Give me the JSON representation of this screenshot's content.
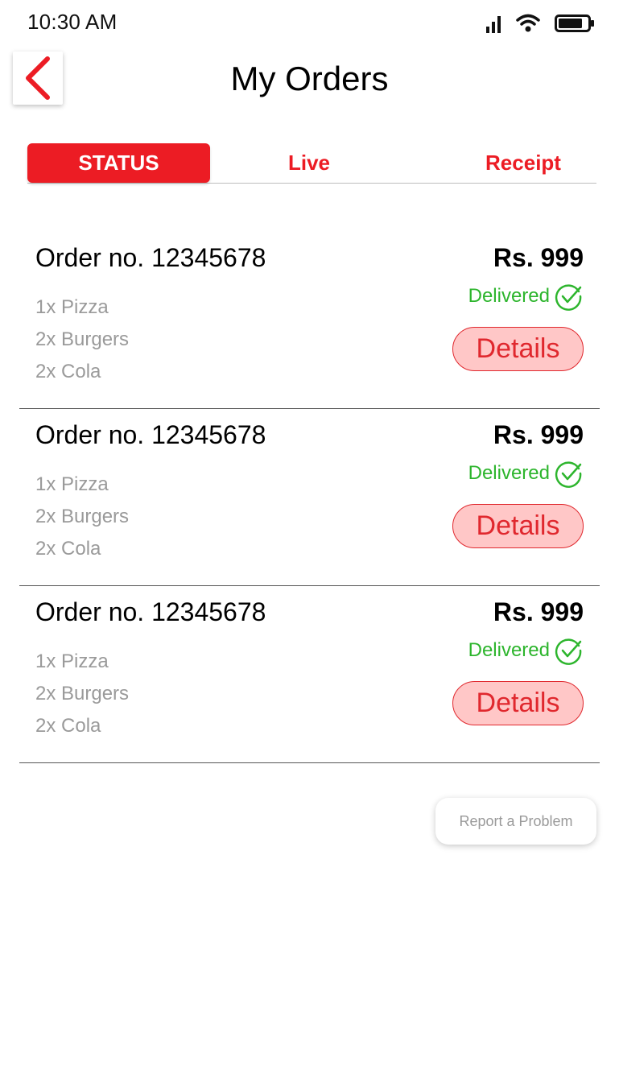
{
  "status_bar": {
    "time": "10:30 AM",
    "icons": [
      "signal-icon",
      "wifi-icon",
      "battery-icon"
    ]
  },
  "header": {
    "back_icon": "chevron-left-icon",
    "title": "My Orders"
  },
  "tabs": [
    {
      "label": "STATUS",
      "active": true
    },
    {
      "label": "Live",
      "active": false
    },
    {
      "label": "Receipt",
      "active": false
    }
  ],
  "orders": [
    {
      "number": "Order no. 12345678",
      "items": [
        "1x Pizza",
        "2x Burgers",
        "2x Cola"
      ],
      "price": "Rs. 999",
      "status": "Delivered",
      "status_icon": "check-circle-icon",
      "details_label": "Details"
    },
    {
      "number": "Order no. 12345678",
      "items": [
        "1x Pizza",
        "2x Burgers",
        "2x Cola"
      ],
      "price": "Rs. 999",
      "status": "Delivered",
      "status_icon": "check-circle-icon",
      "details_label": "Details"
    },
    {
      "number": "Order no. 12345678",
      "items": [
        "1x Pizza",
        "2x Burgers",
        "2x Cola"
      ],
      "price": "Rs. 999",
      "status": "Delivered",
      "status_icon": "check-circle-icon",
      "details_label": "Details"
    }
  ],
  "report_button": "Report a Problem",
  "colors": {
    "accent": "#ec1c24",
    "delivered": "#2db52d",
    "details_bg": "#ffc7c7",
    "muted_text": "#9a9a9a"
  }
}
